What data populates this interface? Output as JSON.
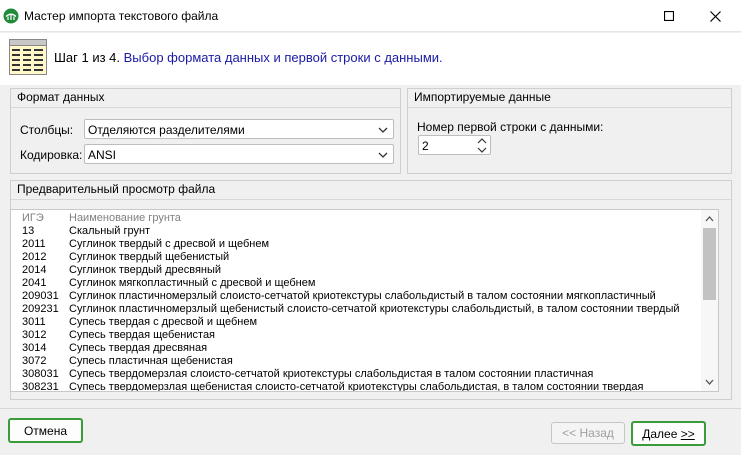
{
  "window": {
    "title": "Мастер импорта текстового файла",
    "icon": "geo-app-icon"
  },
  "header": {
    "step_prefix": "Шаг 1 из 4.",
    "step_desc": "Выбор формата данных и первой строки с данными."
  },
  "format_group": {
    "title": "Формат данных",
    "columns_label": "Столбцы:",
    "columns_value": "Отделяются разделителями",
    "encoding_label": "Кодировка:",
    "encoding_value": "ANSI"
  },
  "import_group": {
    "title": "Импортируемые данные",
    "first_row_label": "Номер первой строки с данными:",
    "first_row_value": "2"
  },
  "preview": {
    "title": "Предварительный просмотр файла",
    "header": [
      "ИГЭ",
      "Наименование грунта"
    ],
    "rows": [
      [
        "13",
        "Скальный грунт"
      ],
      [
        "2011",
        "Суглинок твердый с дресвой и щебнем"
      ],
      [
        "2012",
        "Суглинок твердый щебенистый"
      ],
      [
        "2014",
        "Суглинок твердый дресвяный"
      ],
      [
        "2041",
        "Суглинок мягкопластичный с дресвой и щебнем"
      ],
      [
        "209031",
        "Суглинок пластичномерзлый слоисто-сетчатой криотекстуры слабольдистый в талом состоянии мягкопластичный"
      ],
      [
        "209231",
        "Суглинок пластичномерзлый щебенистый слоисто-сетчатой криотекстуры слабольдистый, в талом состоянии твердый"
      ],
      [
        "3011",
        "Супесь твердая с дресвой и щебнем"
      ],
      [
        "3012",
        "Супесь твердая щебенистая"
      ],
      [
        "3014",
        "Супесь твердая дресвяная"
      ],
      [
        "3072",
        "Супесь пластичная щебенистая"
      ],
      [
        "308031",
        "Супесь твердомерзлая слоисто-сетчатой криотекстуры слабольдистая в талом состоянии пластичная"
      ],
      [
        "308231",
        "Супесь твердомерзлая щебенистая слоисто-сетчатой криотекстуры слабольдистая, в талом состоянии твердая"
      ]
    ]
  },
  "buttons": {
    "cancel": "Отмена",
    "back_prefix": "<< ",
    "back_label": "Назад",
    "next_label": "Далее",
    "next_suffix": ">>"
  },
  "colors": {
    "accent_green": "#3a9b3a",
    "step_desc_blue": "#1a1aa6"
  }
}
